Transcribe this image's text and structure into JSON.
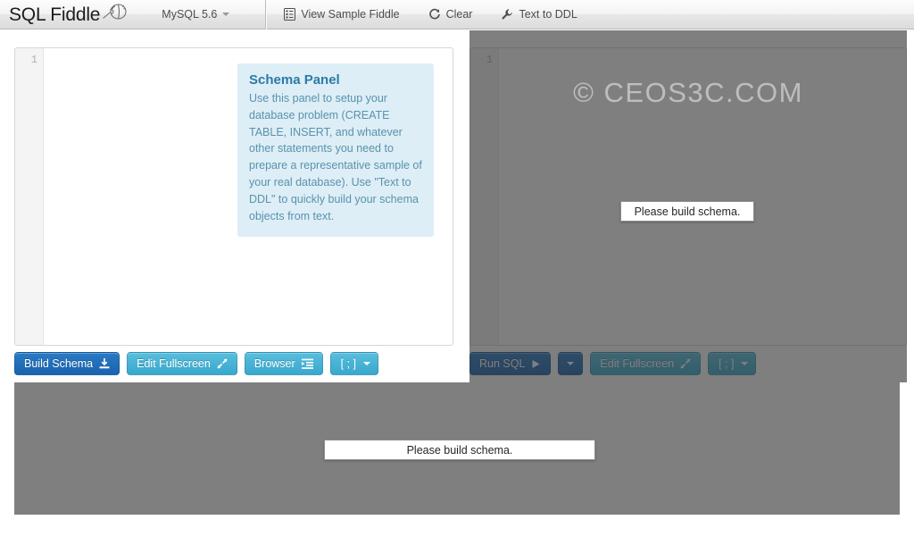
{
  "toolbar": {
    "brand": "SQL Fiddle",
    "brand_icon": "fiddle-violin-icon",
    "db_selector": {
      "label": "MySQL 5.6",
      "icon": "chevron-down-icon"
    },
    "items": [
      {
        "label": "View Sample Fiddle",
        "icon": "document-list-icon"
      },
      {
        "label": "Clear",
        "icon": "refresh-icon"
      },
      {
        "label": "Text to DDL",
        "icon": "wrench-icon"
      }
    ]
  },
  "schema_panel": {
    "gutter_line": "1",
    "callout": {
      "title": "Schema Panel",
      "body": "Use this panel to setup your database problem (CREATE TABLE, INSERT, and whatever other statements you need to prepare a representative sample of your real database). Use \"Text to DDL\" to quickly build your schema objects from text."
    },
    "buttons": [
      {
        "label": "Build Schema",
        "icon": "download-icon",
        "style": "primary"
      },
      {
        "label": "Edit Fullscreen",
        "icon": "expand-arrows-icon",
        "style": "info"
      },
      {
        "label": "Browser",
        "icon": "indent-icon",
        "style": "info"
      },
      {
        "label": "[ ; ]",
        "icon": "chevron-down-icon",
        "style": "info"
      }
    ]
  },
  "query_panel": {
    "gutter_line": "1",
    "watermark": "© CEOS3C.COM",
    "message": "Please build schema.",
    "buttons": [
      {
        "label": "Run SQL",
        "icon": "play-icon",
        "style": "primary"
      },
      {
        "label": "",
        "icon": "chevron-down-icon",
        "style": "primary"
      },
      {
        "label": "Edit Fullscreen",
        "icon": "expand-arrows-icon",
        "style": "info"
      },
      {
        "label": "[ ; ]",
        "icon": "chevron-down-icon",
        "style": "info"
      }
    ]
  },
  "results_panel": {
    "message": "Please build schema."
  },
  "colors": {
    "accent_blue": "#1a63ae",
    "info_teal": "#38a8cd",
    "callout_bg": "#ddeef6",
    "callout_heading": "#2b7aa8",
    "callout_text": "#5a92ad",
    "dim_overlay": "#303030"
  }
}
